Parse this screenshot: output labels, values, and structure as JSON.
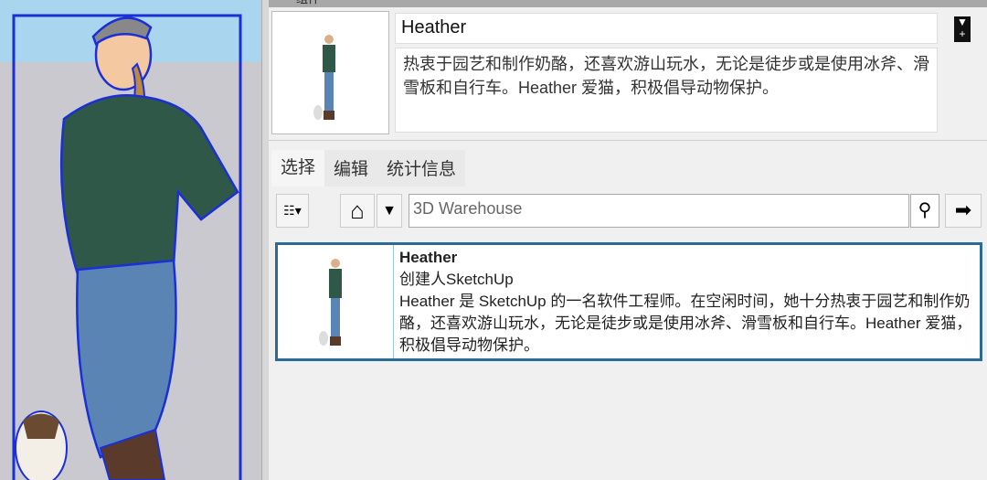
{
  "panel": {
    "title": "组件"
  },
  "component": {
    "name": "Heather",
    "description": "热衷于园艺和制作奶酪，还喜欢游山玩水，无论是徒步或是使用冰斧、滑雪板和自行车。Heather 爱猫，积极倡导动物保护。"
  },
  "tabs": [
    {
      "label": "选择"
    },
    {
      "label": "编辑"
    },
    {
      "label": "统计信息"
    }
  ],
  "search": {
    "value": "3D Warehouse"
  },
  "results": [
    {
      "title": "Heather",
      "creator": "创建人SketchUp",
      "description": "Heather 是 SketchUp 的一名软件工程师。在空闲时间，她十分热衷于园艺和制作奶酪，还喜欢游山玩水，无论是徒步或是使用冰斧、滑雪板和自行车。Heather 爱猫，积极倡导动物保护。"
    }
  ],
  "colors": {
    "selection": "#2a6b96",
    "sky": "#a9d5ef",
    "ground": "#c9c9cf",
    "shirt": "#2f5848",
    "jeans": "#5a84b4"
  }
}
